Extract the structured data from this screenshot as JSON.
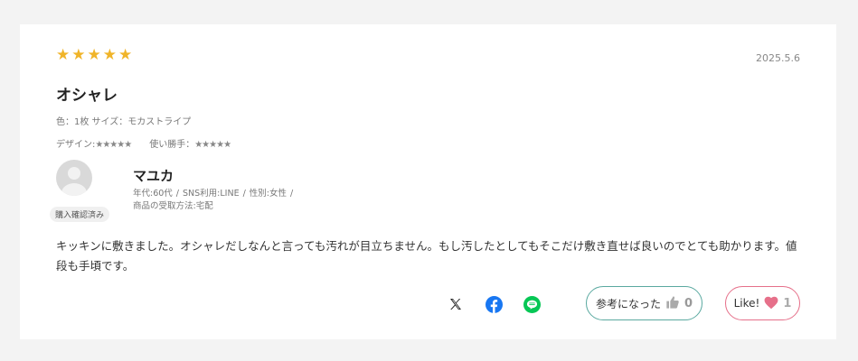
{
  "review": {
    "star": "★",
    "date": "2025.5.6",
    "title": "オシャレ",
    "variant": "色：1枚 サイズ：モカストライプ",
    "design_label": "デザイン:",
    "design_stars": "★★★★★",
    "usability_label": "使い勝手：",
    "usability_stars": "★★★★★",
    "body": "キッキンに敷きました。オシャレだしなんと言っても汚れが目立ちません。もし汚したとしてもそこだけ敷き直せば良いのでとても助かります。値段も手頃です。"
  },
  "reviewer": {
    "name": "マユカ",
    "age": "年代:60代",
    "sns": "SNS利用:LINE",
    "gender": "性別:女性",
    "receive": "商品の受取方法:宅配",
    "sep": "/",
    "badge": "購入確認済み"
  },
  "actions": {
    "helpful_label": "参考になった",
    "helpful_count": "0",
    "like_label": "Like!",
    "like_count": "1"
  },
  "colors": {
    "star": "#f0b429",
    "helpful_border": "#5aa9a0",
    "like_border": "#e6708a",
    "facebook": "#1877f2",
    "line": "#06c755"
  },
  "icons": [
    "x-icon",
    "facebook-icon",
    "line-icon",
    "thumbs-up-icon",
    "heart-icon",
    "avatar-icon"
  ]
}
